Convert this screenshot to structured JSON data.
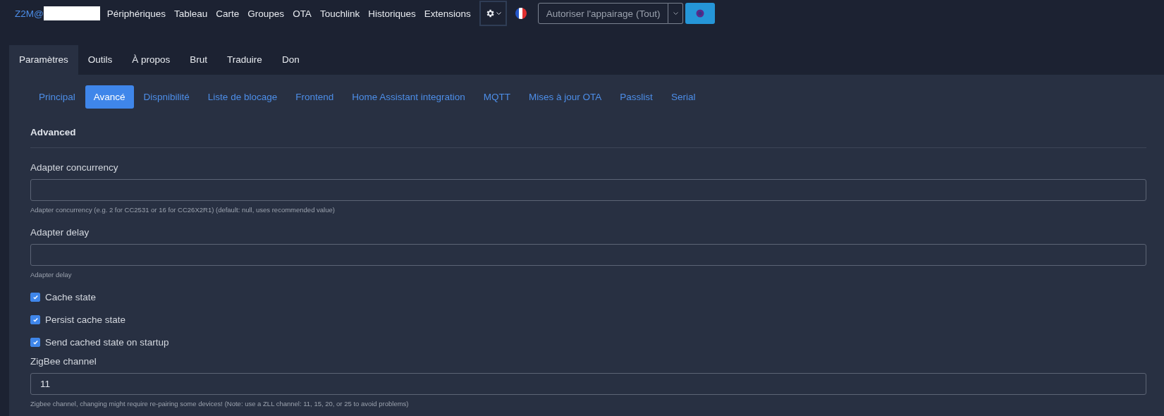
{
  "navbar": {
    "brand": "Z2M@",
    "links": [
      "Périphériques",
      "Tableau",
      "Carte",
      "Groupes",
      "OTA",
      "Touchlink",
      "Historiques",
      "Extensions"
    ],
    "permit_join": "Autoriser l'appairage (Tout)"
  },
  "tabs": [
    {
      "label": "Paramètres",
      "selected": true
    },
    {
      "label": "Outils",
      "selected": false
    },
    {
      "label": "À propos",
      "selected": false
    },
    {
      "label": "Brut",
      "selected": false
    },
    {
      "label": "Traduire",
      "selected": false
    },
    {
      "label": "Don",
      "selected": false
    }
  ],
  "subtabs": [
    {
      "label": "Principal",
      "selected": false
    },
    {
      "label": "Avancé",
      "selected": true
    },
    {
      "label": "Dispnibilité",
      "selected": false
    },
    {
      "label": "Liste de blocage",
      "selected": false
    },
    {
      "label": "Frontend",
      "selected": false
    },
    {
      "label": "Home Assistant integration",
      "selected": false
    },
    {
      "label": "MQTT",
      "selected": false
    },
    {
      "label": "Mises à jour OTA",
      "selected": false
    },
    {
      "label": "Passlist",
      "selected": false
    },
    {
      "label": "Serial",
      "selected": false
    }
  ],
  "section_title": "Advanced",
  "fields": [
    {
      "kind": "text",
      "label": "Adapter concurrency",
      "help": "Adapter concurrency (e.g. 2 for CC2531 or 16 for CC26X2R1) (default: null, uses recommended value)"
    },
    {
      "kind": "text",
      "label": "Adapter delay",
      "help": "Adapter delay"
    },
    {
      "kind": "checkbox",
      "label": "Cache state",
      "checked": true
    },
    {
      "kind": "checkbox",
      "label": "Persist cache state",
      "checked": true
    },
    {
      "kind": "checkbox",
      "label": "Send cached state on startup",
      "checked": true
    },
    {
      "kind": "text",
      "label": "ZigBee channel",
      "value": "11",
      "help": "Zigbee channel, changing might require re-pairing some devices! (Note: use a ZLL channel: 11, 15, 20, or 25 to avoid problems)"
    }
  ]
}
